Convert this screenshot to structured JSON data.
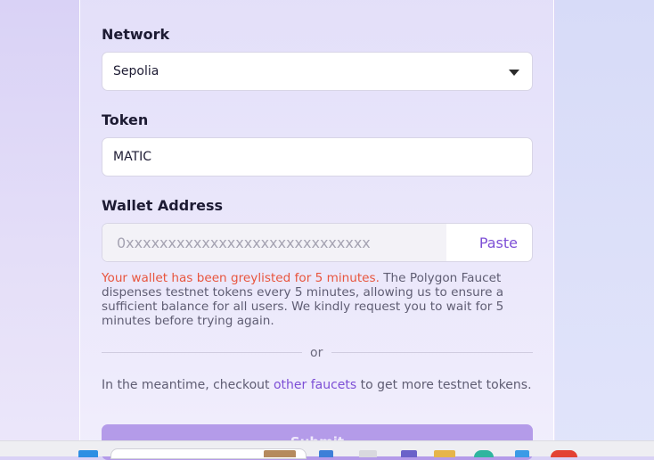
{
  "form": {
    "network": {
      "label": "Network",
      "selected": "Sepolia"
    },
    "token": {
      "label": "Token",
      "value": "MATIC"
    },
    "wallet": {
      "label": "Wallet Address",
      "placeholder": "0xxxxxxxxxxxxxxxxxxxxxxxxxxxxx",
      "paste_label": "Paste"
    },
    "notice": {
      "warning": "Your wallet has been greylisted for 5 minutes.",
      "body": " The Polygon Faucet dispenses testnet tokens every 5 minutes, allowing us to ensure a sufficient balance for all users. We kindly request you to wait for 5 minutes before trying again."
    },
    "divider_text": "or",
    "meantime": {
      "before": "In the meantime, checkout ",
      "link": "other faucets",
      "after": " to get more testnet tokens."
    },
    "submit_label": "Submit"
  },
  "colors": {
    "accent": "#7d4fd6",
    "warning": "#e8553e",
    "submit_bg": "#b49be9"
  },
  "taskbar": {
    "icons": [
      "windows-start-icon",
      "search-box",
      "copilot-icon",
      "folder-icon",
      "teams-icon",
      "file-explorer-icon",
      "edge-icon",
      "store-icon",
      "chrome-icon"
    ]
  }
}
